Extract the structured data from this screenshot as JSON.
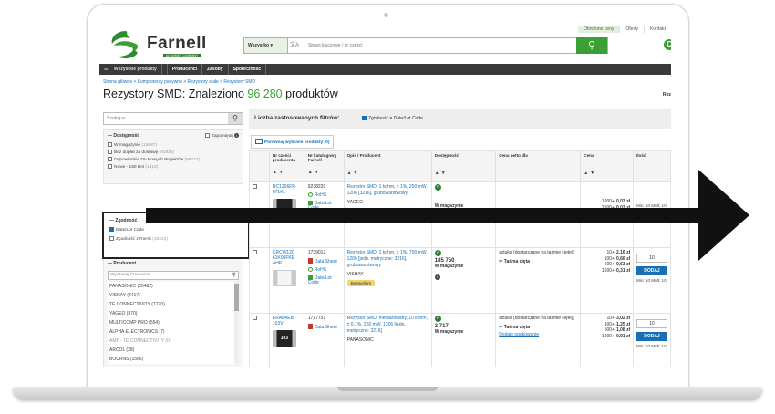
{
  "header": {
    "top_links": [
      "Obniżone ceny",
      "Oferty",
      "Kontakt"
    ],
    "brand": "Farnell",
    "brand_tagline": "AN AVNET COMPANY",
    "search": {
      "scope": "Wszystko",
      "placeholder": "Słowo kluczowe / nr części"
    },
    "nav": [
      "Wszystkie produkty",
      "Producenci",
      "Zasoby",
      "Społeczność"
    ]
  },
  "breadcrumb": "Strona główna > Komponenty pasywne > Rezystory stałe > Rezystory SMD",
  "page_title": {
    "prefix": "Rezystory SMD: Znaleziono ",
    "count": "96 280",
    "suffix": " produktów"
  },
  "sort_label": "Roz",
  "sidebar": {
    "search_placeholder": "Szukaj w...",
    "availability": {
      "heading": "Dostępność",
      "remember": "Zapamiętaj",
      "items": [
        {
          "label": "W magazynie",
          "count": "(15887)"
        },
        {
          "label": "Bez dopłat za dostawę",
          "count": "(91926)"
        },
        {
          "label": "Odpowiednie Do Nowych Projektów",
          "count": "(96227)"
        },
        {
          "label": "Nowe - 180 Dni",
          "count": "(1415)"
        }
      ]
    },
    "compliance": {
      "heading": "Zgodność",
      "items": [
        {
          "label": "Date/Lot Code",
          "count": "",
          "checked": true
        },
        {
          "label": "Zgodność z RoHS",
          "count": "(26223)",
          "checked": false
        }
      ]
    },
    "manufacturer": {
      "heading": "Producent",
      "search_placeholder": "Wyszukaj Producent",
      "items": [
        "PANASONIC (65482)",
        "VISHAY (8417)",
        "TE CONNECTIVITY (1220)",
        "YAGEO (870)",
        "MULTICOMP PRO (554)",
        "ALPHA ELECTRONICS (7)",
        "AMP - TE CONNECTIVITY (0)",
        "ARCOL (28)",
        "BOURNS (1566)"
      ]
    }
  },
  "filters": {
    "label": "Liczba zastosowanych filtrów:",
    "applied": "Zgodność = Date/Lot Code"
  },
  "compare_button": "Porównaj wybrane produkty (0)",
  "table": {
    "headers": [
      "Nr części producenta",
      "Nr katalogowy Farnell",
      "Opis / Producent",
      "Dostępność",
      "Cena netto dla",
      "Cena",
      "Ilość"
    ],
    "sort_arrows": "▲▼",
    "rows": [
      {
        "part": "RC1206FR-071KL",
        "cat": "9238220",
        "desc": "Rezystor SMD, 1 kohm, ± 1%, 250 mW, 1206 [3216], grubowarstwowy",
        "brand": "YAGEO",
        "stock": "W magazynie",
        "pack": "",
        "cut": "",
        "prices": [
          [
            "1000+",
            "0,03 zł"
          ],
          [
            "2500+",
            "0,07 zł"
          ]
        ],
        "more": "Więcej cen",
        "qty": "10",
        "min": "Min: 10 Mult: 10",
        "docs": [
          "RoHS",
          "Date/Lot Code"
        ],
        "best": "Bestsellers"
      },
      {
        "part": "CRCW120 61K00FKE AHP",
        "cat": "1739012",
        "desc": "Rezystor SMD, 1 kohm, ± 1%, 750 mW, 1206 [jedn. metryczne: 3216], grubowarstwowy",
        "brand": "VISHAY",
        "stock_count": "185 750",
        "stock": "W magazynie",
        "pack": "sztuka (dostarczane na taśmie ciętej)",
        "cut": "Taśma cięta",
        "prices": [
          [
            "10+",
            "2,16 zł"
          ],
          [
            "100+",
            "0,66 zł"
          ],
          [
            "500+",
            "0,63 zł"
          ],
          [
            "1000+",
            "0,31 zł"
          ]
        ],
        "qty": "10",
        "add": "DODAJ",
        "min": "Min: 10 Mult: 10",
        "docs": [
          "Data Sheet",
          "RoHS",
          "Date/Lot Code"
        ],
        "best": "Bestsellers"
      },
      {
        "part": "ERA8AEB 103V",
        "cat": "1717751",
        "desc": "Rezystor SMD, metalizowany, 10 kohm, ± 0.1%, 250 mW, 1206 [jedn. metryczne: 3216]",
        "brand": "PANASONIC",
        "stock_count": "3 717",
        "stock": "W magazynie",
        "pack": "sztuka (dostarczane na taśmie ciętej)",
        "cut": "Taśma cięta",
        "prices": [
          [
            "10+",
            "3,02 zł"
          ],
          [
            "100+",
            "1,25 zł"
          ],
          [
            "500+",
            "1,08 zł"
          ],
          [
            "1000+",
            "0,91 zł"
          ]
        ],
        "more": "Dodaje opakowanie",
        "qty": "10",
        "add": "DODAJ",
        "min": "Min: 10 Mult: 10",
        "docs": [
          "Data Sheet"
        ],
        "part_marking": "103"
      }
    ]
  }
}
